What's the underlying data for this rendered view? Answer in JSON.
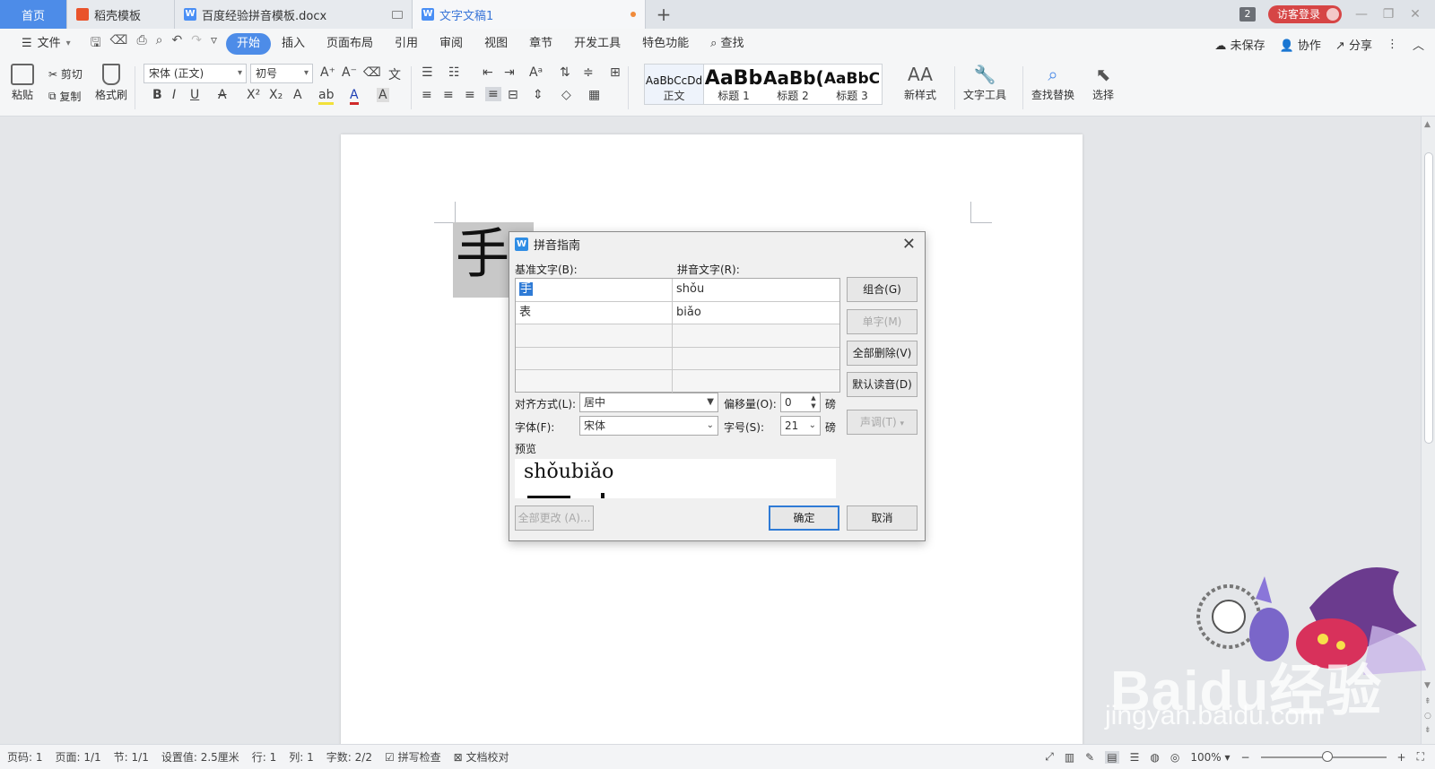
{
  "tabs": [
    {
      "label": "首页"
    },
    {
      "label": "稻壳模板"
    },
    {
      "label": "百度经验拼音模板.docx"
    },
    {
      "label": "文字文稿1"
    }
  ],
  "titlebar": {
    "window_count": "2",
    "login_label": "访客登录"
  },
  "menu": {
    "file": "文件",
    "items": [
      "开始",
      "插入",
      "页面布局",
      "引用",
      "审阅",
      "视图",
      "章节",
      "开发工具",
      "特色功能"
    ],
    "search": "查找",
    "unsaved": "未保存",
    "collab": "协作",
    "share": "分享"
  },
  "ribbon": {
    "paste": "粘贴",
    "cut": "剪切",
    "copy": "复制",
    "format_painter": "格式刷",
    "font_name": "宋体 (正文)",
    "font_size": "初号",
    "styles": [
      {
        "preview": "AaBbCcDd",
        "label": "正文"
      },
      {
        "preview": "AaBb",
        "label": "标题 1"
      },
      {
        "preview": "AaBb(",
        "label": "标题 2"
      },
      {
        "preview": "AaBbC",
        "label": "标题 3"
      }
    ],
    "new_style": "新样式",
    "text_tools": "文字工具",
    "find_replace": "查找替换",
    "select": "选择"
  },
  "document": {
    "text": "手"
  },
  "dialog": {
    "title": "拼音指南",
    "base_label": "基准文字(B):",
    "pinyin_label": "拼音文字(R):",
    "rows": [
      {
        "base": "手",
        "pinyin": "shǒu"
      },
      {
        "base": "表",
        "pinyin": "biǎo"
      },
      {
        "base": "",
        "pinyin": ""
      },
      {
        "base": "",
        "pinyin": ""
      },
      {
        "base": "",
        "pinyin": ""
      }
    ],
    "btn_group": "组合(G)",
    "btn_single": "单字(M)",
    "btn_delete_all": "全部删除(V)",
    "btn_default": "默认读音(D)",
    "btn_tone": "声调(T)",
    "align_label": "对齐方式(L):",
    "align_value": "居中",
    "offset_label": "偏移量(O):",
    "offset_value": "0",
    "offset_unit": "磅",
    "font_label": "字体(F):",
    "font_value": "宋体",
    "size_label": "字号(S):",
    "size_value": "21",
    "size_unit": "磅",
    "preview_label": "预览",
    "preview_text": "shǒubiǎo",
    "btn_change_all": "全部更改 (A)...",
    "btn_ok": "确定",
    "btn_cancel": "取消"
  },
  "statusbar": {
    "page": "页码: 1",
    "pages": "页面: 1/1",
    "section": "节: 1/1",
    "setting": "设置值: 2.5厘米",
    "line": "行: 1",
    "col": "列: 1",
    "words": "字数: 2/2",
    "spell": "拼写检查",
    "proof": "文档校对",
    "zoom": "100%"
  },
  "watermark": {
    "brand": "Baidu经验",
    "url": "jingyan.baidu.com"
  }
}
